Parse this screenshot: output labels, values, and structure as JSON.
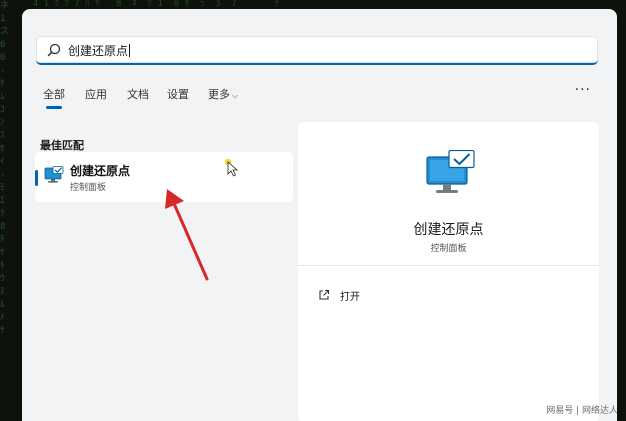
{
  "search": {
    "query": "创建还原点"
  },
  "tabs": [
    {
      "label": "全部",
      "active": true
    },
    {
      "label": "应用",
      "active": false
    },
    {
      "label": "文档",
      "active": false
    },
    {
      "label": "设置",
      "active": false
    },
    {
      "label": "更多",
      "active": false
    }
  ],
  "more_menu_icon": "ellipsis-icon",
  "best_match": {
    "heading": "最佳匹配",
    "title": "创建还原点",
    "subtitle": "控制面板",
    "icon": "monitor-check-icon"
  },
  "detail": {
    "title": "创建还原点",
    "subtitle": "控制面板",
    "action_label": "打开",
    "action_icon": "open-external-icon"
  },
  "watermark": "网易号 | 网络达人",
  "colors": {
    "accent": "#0063b1",
    "arrow": "#d62828",
    "panel": "#f2f3f5",
    "background": "#0d120d"
  }
}
